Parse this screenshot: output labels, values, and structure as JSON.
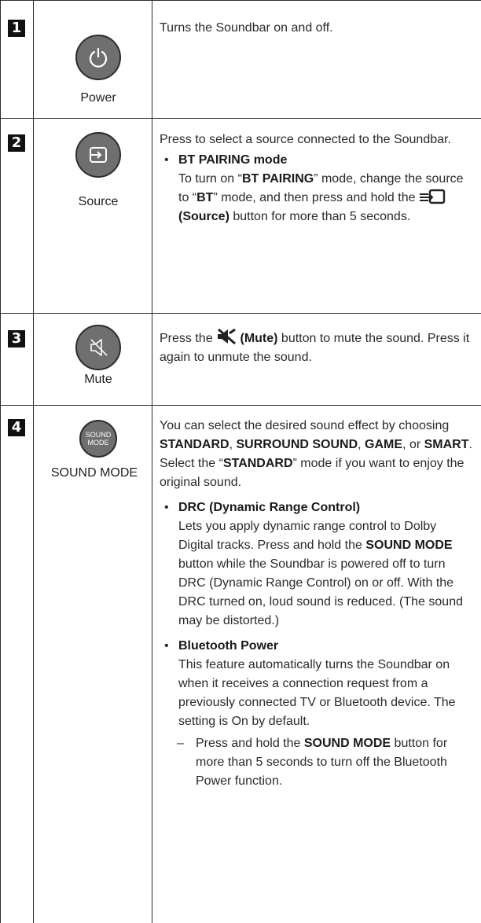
{
  "rows": [
    {
      "number": "1",
      "icon": "power-icon",
      "label": "Power",
      "description": "Turns the Soundbar on and off."
    },
    {
      "number": "2",
      "icon": "source-icon",
      "label": "Source",
      "description": "Press to select a source connected to the Soundbar.",
      "bullet_title": "BT PAIRING mode",
      "bullet_text": {
        "part1": "To turn on “",
        "bold1": "BT PAIRING",
        "part2": "” mode, change the source to “",
        "bold2": "BT",
        "part3": "” mode, and then press and hold the ",
        "bold3": "(Source)",
        "part4": " button for more than 5 seconds."
      }
    },
    {
      "number": "3",
      "icon": "mute-icon",
      "label": "Mute",
      "description": {
        "part1": "Press the ",
        "bold1": "(Mute)",
        "part2": " button to mute the sound. Press it again to unmute the sound."
      }
    },
    {
      "number": "4",
      "icon": "sound-mode-icon",
      "button_text": [
        "SOUND",
        "MODE"
      ],
      "label": "SOUND MODE",
      "intro": {
        "part1": "You can select the desired sound effect by choosing ",
        "bold1": "STANDARD",
        "sep1": ", ",
        "bold2": "SURROUND SOUND",
        "sep2": ", ",
        "bold3": "GAME",
        "sep3": ", or ",
        "bold4": "SMART",
        "end": "."
      },
      "intro2": {
        "part1": "Select the “",
        "bold1": "STANDARD",
        "part2": "” mode if you want to enjoy the original sound."
      },
      "bullet1_title": "DRC (Dynamic Range Control)",
      "bullet1_text": {
        "part1": "Lets you apply dynamic range control to Dolby Digital tracks. Press and hold the ",
        "bold1": "SOUND MODE",
        "part2": " button while the Soundbar is powered off to turn DRC (Dynamic Range Control) on or off. With the DRC turned on, loud sound is reduced. (The sound may be distorted.)"
      },
      "bullet2_title": "Bluetooth Power",
      "bullet2_text": "This feature automatically turns the Soundbar on when it receives a connection request from a previously connected TV or Bluetooth device. The setting is On by default.",
      "dash_text": {
        "part1": "Press and hold the ",
        "bold1": "SOUND MODE",
        "part2": " button for more than 5 seconds to turn off the Bluetooth Power function."
      }
    }
  ],
  "symbols": {
    "bullet": "•",
    "dash": "–"
  }
}
